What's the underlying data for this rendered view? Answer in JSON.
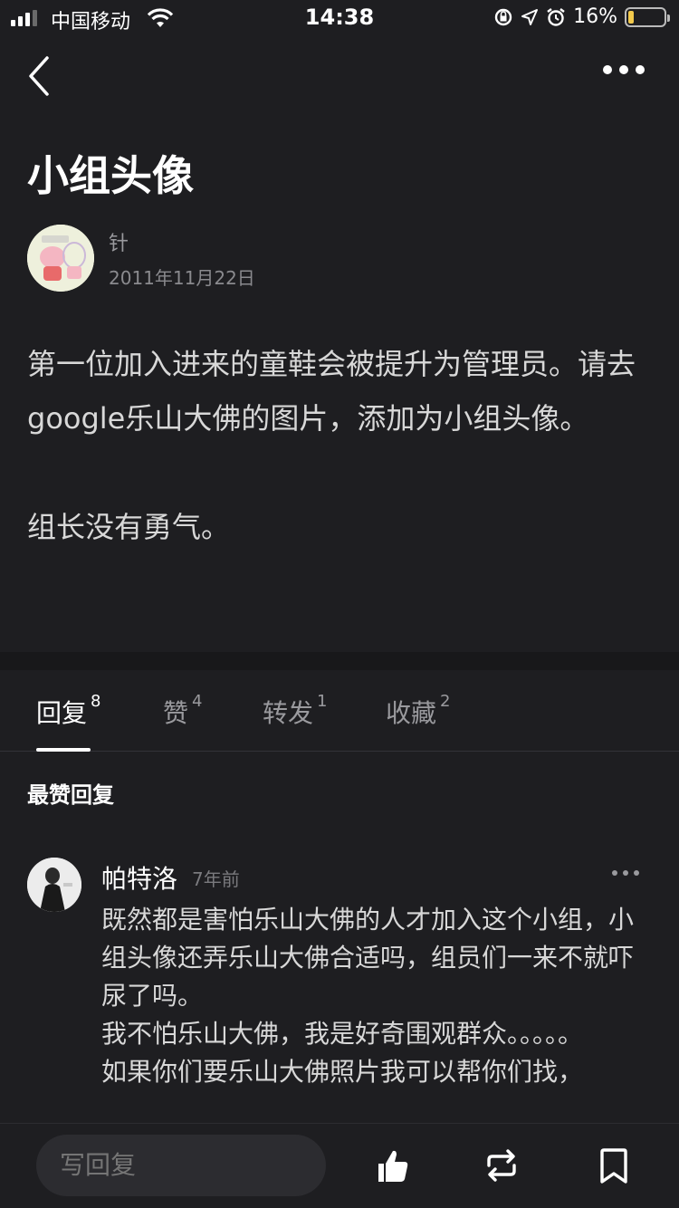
{
  "status_bar": {
    "carrier": "中国移动",
    "time": "14:38",
    "battery_percent_label": "16%",
    "battery_level": 0.16,
    "battery_color": "#f2c94c"
  },
  "post": {
    "title": "小组头像",
    "author": "针",
    "date": "2011年11月22日",
    "paragraphs": [
      "第一位加入进来的童鞋会被提升为管理员。请去google乐山大佛的图片，添加为小组头像。",
      "组长没有勇气。"
    ]
  },
  "tabs": [
    {
      "label": "回复",
      "count": "8",
      "active": true
    },
    {
      "label": "赞",
      "count": "4",
      "active": false
    },
    {
      "label": "转发",
      "count": "1",
      "active": false
    },
    {
      "label": "收藏",
      "count": "2",
      "active": false
    }
  ],
  "section_label": "最赞回复",
  "reply": {
    "name": "帕特洛",
    "time": "7年前",
    "lines": [
      "既然都是害怕乐山大佛的人才加入这个小组，小组头像还弄乐山大佛合适吗，组员们一来不就吓尿了吗。",
      "我不怕乐山大佛，我是好奇围观群众。。。。。",
      "如果你们要乐山大佛照片我可以帮你们找，"
    ]
  },
  "bottom_bar": {
    "reply_placeholder": "写回复",
    "icons": [
      "thumbs-up-icon",
      "repost-icon",
      "bookmark-icon"
    ]
  }
}
